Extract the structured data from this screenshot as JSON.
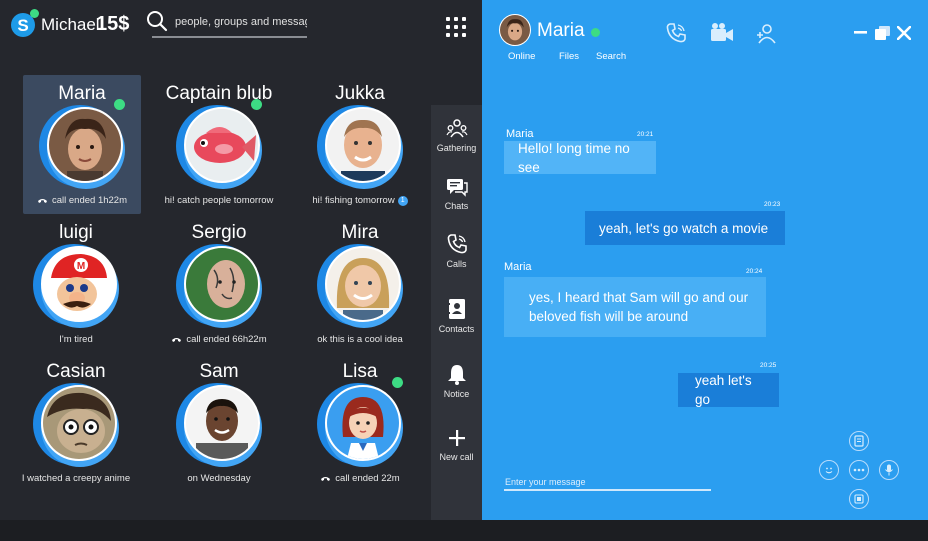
{
  "user": {
    "name": "Michael",
    "balance": "15$"
  },
  "search": {
    "placeholder": "people, groups and messages"
  },
  "contacts": [
    {
      "name": "Maria",
      "status": "call ended 1h22m",
      "status_kind": "call",
      "online": true,
      "selected": true
    },
    {
      "name": "Captain blub",
      "status": "hi! catch people tomorrow",
      "status_kind": "text",
      "online": true
    },
    {
      "name": "Jukka",
      "status": "hi! fishing tomorrow",
      "status_kind": "text",
      "badge": "1",
      "online": false
    },
    {
      "name": "luigi",
      "status": "I'm tired",
      "status_kind": "text",
      "online": false
    },
    {
      "name": "Sergio",
      "status": "call ended 66h22m",
      "status_kind": "call",
      "online": false
    },
    {
      "name": "Mira",
      "status": "ok this is a cool idea",
      "status_kind": "text",
      "online": false
    },
    {
      "name": "Casian",
      "status": "I watched a creepy anime",
      "status_kind": "text",
      "online": false
    },
    {
      "name": "Sam",
      "status": "on Wednesday",
      "status_kind": "text",
      "online": false
    },
    {
      "name": "Lisa",
      "status": "call ended 22m",
      "status_kind": "call",
      "online": true
    }
  ],
  "nav": [
    {
      "label": "Gathering",
      "icon": "gathering-icon"
    },
    {
      "label": "Chats",
      "icon": "chats-icon"
    },
    {
      "label": "Calls",
      "icon": "phone-icon"
    },
    {
      "label": "Contacts",
      "icon": "contacts-icon"
    },
    {
      "label": "Notice",
      "icon": "bell-icon"
    },
    {
      "label": "New call",
      "icon": "plus-icon"
    }
  ],
  "chat": {
    "contact_name": "Maria",
    "tabs": [
      "Online",
      "Files",
      "Search"
    ],
    "messages": [
      {
        "sender": "Maria",
        "time": "20:21",
        "text": "Hello! long time no see",
        "direction": "in"
      },
      {
        "sender": "",
        "time": "20:23",
        "text": "yeah, let's go watch a movie",
        "direction": "out"
      },
      {
        "sender": "Maria",
        "time": "20:24",
        "text": "yes, I heard that Sam will go and our beloved fish will be around",
        "direction": "in"
      },
      {
        "sender": "",
        "time": "20:25",
        "text": "yeah let's go",
        "direction": "out"
      }
    ],
    "composer_placeholder": "Enter your message"
  },
  "colors": {
    "dark_bg": "#25272d",
    "chat_bg": "#2b9ef0",
    "accent_blue": "#1a7ed8",
    "online": "#3ddc84"
  }
}
